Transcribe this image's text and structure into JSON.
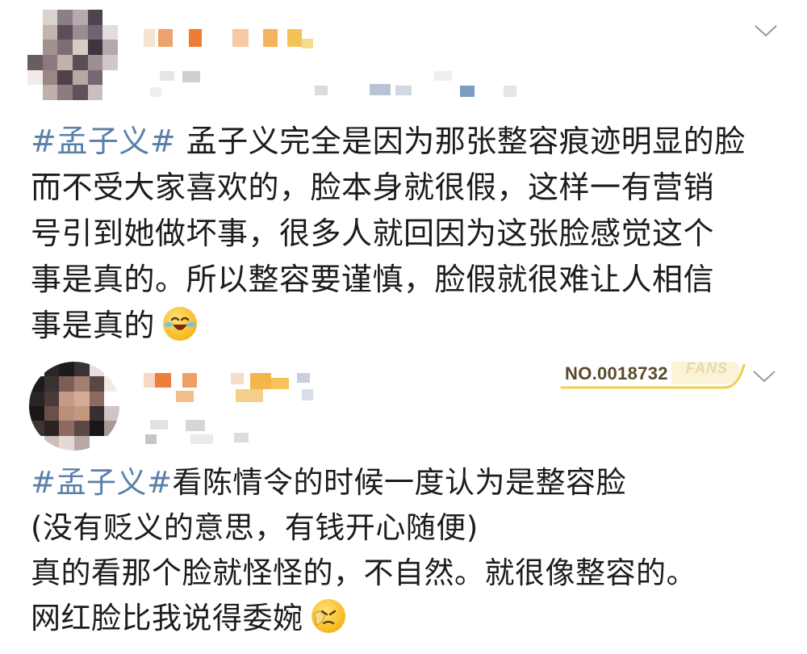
{
  "posts": [
    {
      "lines": [
        {
          "hashtag": "#孟子义#",
          "text": " 孟子义完全是因为那张整容痕迹明显的脸"
        },
        {
          "hashtag": "",
          "text": "而不受大家喜欢的，脸本身就很假，这样一有营销"
        },
        {
          "hashtag": "",
          "text": "号引到她做坏事，很多人就回因为这张脸感觉这个"
        },
        {
          "hashtag": "",
          "text": "事是真的。所以整容要谨慎，脸假就很难让人相信"
        },
        {
          "hashtag": "",
          "text": "事是真的"
        }
      ],
      "emoji": "laughing-crying-emoji"
    },
    {
      "fans_badge": {
        "number": "NO.0018732",
        "label": "FANS"
      },
      "lines": [
        {
          "hashtag": "#孟子义#",
          "text": "看陈情令的时候一度认为是整容脸"
        },
        {
          "hashtag": "",
          "text": "(没有贬义的意思，有钱开心随便)"
        },
        {
          "hashtag": "",
          "text": "真的看那个脸就怪怪的，不自然。就很像整容的。"
        },
        {
          "hashtag": "",
          "text": "网红脸比我说得委婉"
        }
      ],
      "emoji": "facepalm-emoji"
    }
  ],
  "colors": {
    "hashtag": "#5a7fa8",
    "text": "#1c1c1c",
    "badge_gold": "#f2cd4c"
  }
}
